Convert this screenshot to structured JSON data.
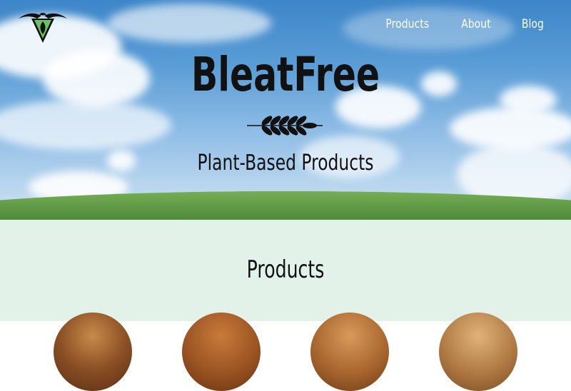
{
  "brand": {
    "logo_icon": "firefly-leaf-logo-icon",
    "title": "BleatFree",
    "divider_icon": "wheat-icon",
    "tagline": "Plant-Based Products"
  },
  "nav": {
    "items": [
      {
        "label": "Products"
      },
      {
        "label": "About"
      },
      {
        "label": "Blog"
      }
    ]
  },
  "products_section": {
    "heading": "Products",
    "thumbnails": [
      {
        "name": "product-1"
      },
      {
        "name": "product-2"
      },
      {
        "name": "product-3"
      },
      {
        "name": "product-4"
      }
    ]
  },
  "colors": {
    "sky": "#5a9dd6",
    "grass": "#4f8a3a",
    "section_bg": "#e2f2e8",
    "text": "#111111",
    "nav_text": "#ffffff",
    "logo_green": "#6cbf6a"
  }
}
